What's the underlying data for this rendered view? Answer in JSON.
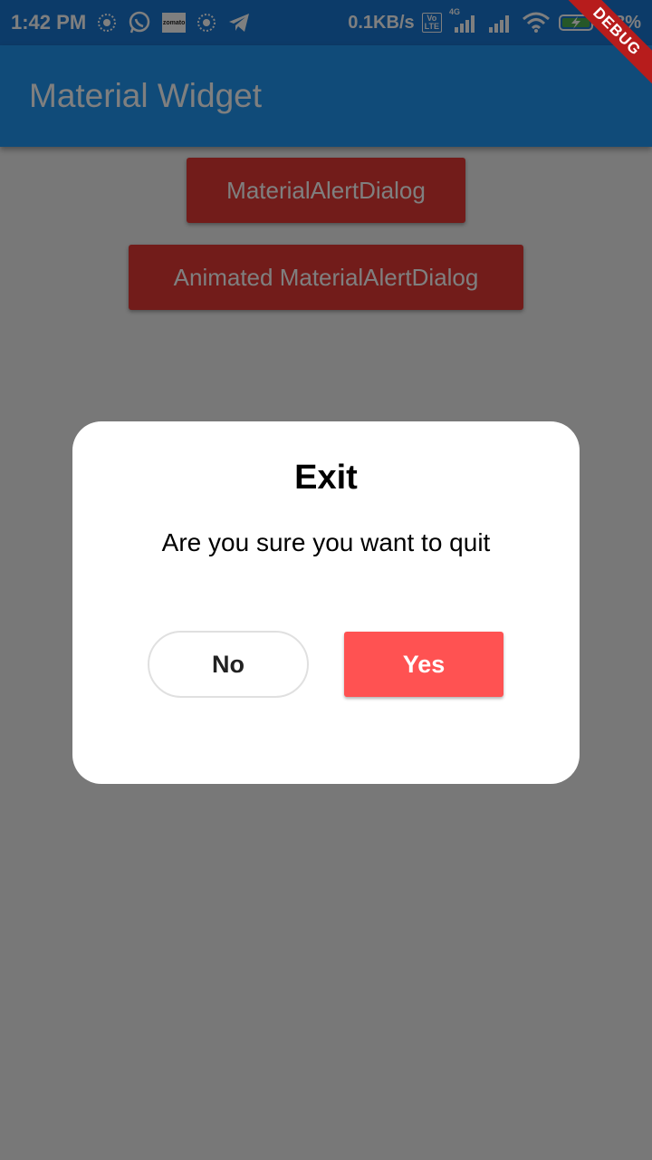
{
  "status_bar": {
    "time": "1:42 PM",
    "zomato": "zomato",
    "net_speed": "0.1KB/s",
    "volte_top": "Vo",
    "volte_bottom": "LTE",
    "network_type": "4G",
    "battery_percent": "98%"
  },
  "debug_banner": "DEBUG",
  "app_bar": {
    "title": "Material Widget"
  },
  "buttons": {
    "material_alert_dialog": "MaterialAlertDialog",
    "animated_material_alert_dialog": "Animated MaterialAlertDialog"
  },
  "dialog": {
    "title": "Exit",
    "message": "Are you sure you want to quit",
    "negative_label": "No",
    "positive_label": "Yes"
  },
  "colors": {
    "app_bar": "#2196f3",
    "status_bar": "#1976d2",
    "button_red": "#e53935",
    "yes_button": "#ff5252",
    "debug_banner": "#b71c1c"
  }
}
